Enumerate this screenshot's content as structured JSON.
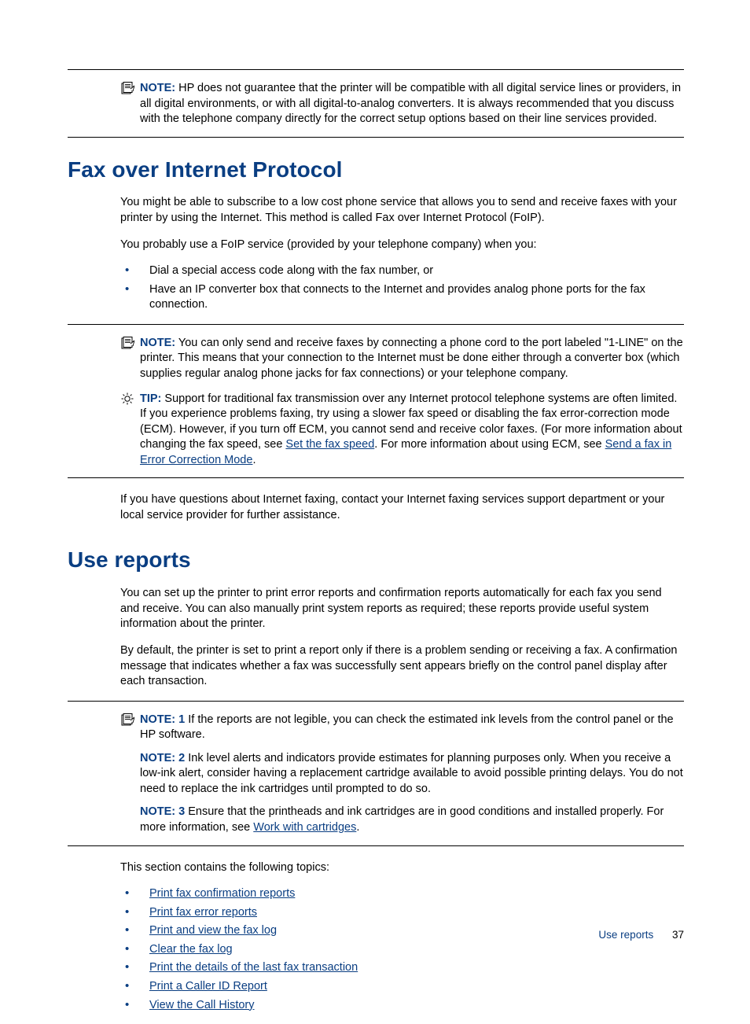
{
  "topNote": {
    "label": "NOTE:",
    "text": "HP does not guarantee that the printer will be compatible with all digital service lines or providers, in all digital environments, or with all digital-to-analog converters. It is always recommended that you discuss with the telephone company directly for the correct setup options based on their line services provided."
  },
  "section1": {
    "heading": "Fax over Internet Protocol",
    "p1": "You might be able to subscribe to a low cost phone service that allows you to send and receive faxes with your printer by using the Internet. This method is called Fax over Internet Protocol (FoIP).",
    "p2": "You probably use a FoIP service (provided by your telephone company) when you:",
    "bullets": [
      "Dial a special access code along with the fax number, or",
      "Have an IP converter box that connects to the Internet and provides analog phone ports for the fax connection."
    ],
    "note": {
      "label": "NOTE:",
      "text": "You can only send and receive faxes by connecting a phone cord to the port labeled \"1-LINE\" on the printer. This means that your connection to the Internet must be done either through a converter box (which supplies regular analog phone jacks for fax connections) or your telephone company."
    },
    "tip": {
      "label": "TIP:",
      "text1": "Support for traditional fax transmission over any Internet protocol telephone systems are often limited. If you experience problems faxing, try using a slower fax speed or disabling the fax error-correction mode (ECM). However, if you turn off ECM, you cannot send and receive color faxes. (For more information about changing the fax speed, see ",
      "link1": "Set the fax speed",
      "text2": ". For more information about using ECM, see ",
      "link2": "Send a fax in Error Correction Mode",
      "text3": "."
    },
    "p3": "If you have questions about Internet faxing, contact your Internet faxing services support department or your local service provider for further assistance."
  },
  "section2": {
    "heading": "Use reports",
    "p1": "You can set up the printer to print error reports and confirmation reports automatically for each fax you send and receive. You can also manually print system reports as required; these reports provide useful system information about the printer.",
    "p2": "By default, the printer is set to print a report only if there is a problem sending or receiving a fax. A confirmation message that indicates whether a fax was successfully sent appears briefly on the control panel display after each transaction.",
    "note1": {
      "label": "NOTE: 1",
      "text": "If the reports are not legible, you can check the estimated ink levels from the control panel or the HP software."
    },
    "note2": {
      "label": "NOTE: 2",
      "text": "Ink level alerts and indicators provide estimates for planning purposes only. When you receive a low-ink alert, consider having a replacement cartridge available to avoid possible printing delays. You do not need to replace the ink cartridges until prompted to do so."
    },
    "note3": {
      "label": "NOTE: 3",
      "text1": "Ensure that the printheads and ink cartridges are in good conditions and installed properly. For more information, see ",
      "link": "Work with cartridges",
      "text2": "."
    },
    "p3": "This section contains the following topics:",
    "topics": [
      "Print fax confirmation reports",
      "Print fax error reports",
      "Print and view the fax log",
      "Clear the fax log",
      "Print the details of the last fax transaction",
      "Print a Caller ID Report",
      "View the Call History"
    ]
  },
  "footer": {
    "title": "Use reports",
    "page": "37"
  }
}
